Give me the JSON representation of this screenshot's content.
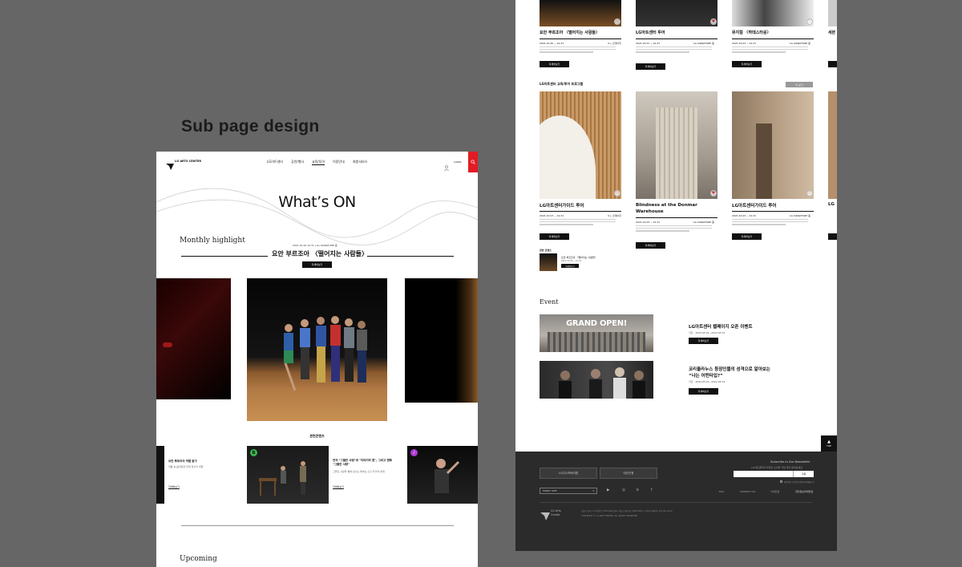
{
  "caption": "Sub page design",
  "left_page": {
    "logo_text": "LG ARTS CENTER",
    "nav": [
      "LG아트센터",
      "공연/행사",
      "교육/투어",
      "이용안내",
      "회원서비스"
    ],
    "login_label": "LOGIN",
    "hero_title": "What’s ON",
    "monthly_label": "Monthly highlight",
    "highlight": {
      "meta": "2021.10.20-10.31 | LG SIGNATURE 홀",
      "title": "요안 부르조아 〈떨어지는 사람들〉",
      "button": "자세히보기"
    },
    "related_label": "관련콘텐츠",
    "related": [
      {
        "title": "요안 부르조아 작품 탐구",
        "desc": "작품 속 움직임과 무대 연출의 비밀",
        "link": "자세히보기"
      },
      {
        "badge": "B",
        "title": "연극 \"그을린 사랑\"과 \"이야기의 힘\", 그리고 영화 \"그을린 사랑\"",
        "desc": "그을린 사랑을 통해 만나는 레바논 출신 작가의 세계",
        "link": "자세히보기"
      },
      {
        "badge": "♪"
      }
    ],
    "upcoming_label": "Upcoming"
  },
  "right_page": {
    "top_cards": [
      {
        "title": "요안 부르조아 〈떨어지는 사람들〉",
        "date": "2021.10.20 ~ 10.31",
        "venue": "U+ 스테이지",
        "button": "자세히보기"
      },
      {
        "title": "LG아트센터 투어",
        "date": "2021.10.01 ~ 10.31",
        "venue": "LG SIGNATURE 홀",
        "button": "자세히보기"
      },
      {
        "title": "뮤지컬 〈하데스타운〉",
        "date": "2021.10.03 ~ 10.31",
        "venue": "LG SIGNATURE 홀",
        "button": "자세히보기"
      },
      {
        "title": "세븐"
      }
    ],
    "section2_label": "LG아트센터 교육/투어 프로그램",
    "section2_more": "더 보기",
    "mid_cards": [
      {
        "title": "LG아트센터가이드 투어",
        "date": "2021.10.03 ~ 10.31",
        "venue": "U+ 스테이지",
        "button": "자세히보기"
      },
      {
        "title": "Blindness at the Donmar Warehouse",
        "date": "2021.10.03 ~ 10.31",
        "venue": "LG SIGNATURE 홀",
        "button": "자세히보기"
      },
      {
        "title": "LG아트센터가이드 투어",
        "date": "2021.10.03 ~ 10.31",
        "venue": "LG SIGNATURE 홀",
        "button": "자세히보기"
      },
      {
        "title": "LG"
      }
    ],
    "related_small": {
      "label": "관련 콘텐츠",
      "title": "요안 부르조아 〈떨어지는 사람들〉",
      "date": "2021.10.20 ~ 10.31",
      "button": "자세히보기"
    },
    "event_label": "Event",
    "events": [
      {
        "banner": "GRAND OPEN!",
        "title": "LG아트센터 웹페이지 오픈 이벤트",
        "period": "기간 : 2022.05.01~2022.05.31",
        "button": "자세히보기"
      },
      {
        "title_line1": "코리올라누스 등장인물의 성격으로 알아보는",
        "title_line2": "“나는 어떤타입?”",
        "period": "기간 : 2022.05.01~2022.05.31",
        "button": "자세히보기"
      }
    ],
    "top_button": "TOP",
    "footer": {
      "btn1": "LG디스커버리랩",
      "btn2": "대관신청",
      "newsletter_label": "Subscribe to Our Newsletter",
      "newsletter_desc": "LG아트센터의 다양한 소식을 가장 먼저 받아보세요",
      "subscribe_button": "구독",
      "agree_text": "개인정보 수집 및 이용에 동의합니다",
      "family_site": "FAMILY SITE",
      "social": [
        "▶",
        "◎",
        "b",
        "f"
      ],
      "links": [
        "FAQ",
        "CONTACT US",
        "사이트맵",
        "개인정보처리방침"
      ],
      "logo": "LG Arts Center",
      "copyright_line1": "서울시 강서구 마곡중앙로 136 LG아트센터 서울 | 대표번호 1661-0017 | 사업자등록번호 107-81-xxxxx",
      "copyright_line2": "COPYRIGHT © LG ARTS CENTER. ALL RIGHTS RESERVED."
    }
  },
  "colors": {
    "background": "#666666",
    "accent_red": "#e31b23",
    "footer": "#2b2b2b"
  }
}
